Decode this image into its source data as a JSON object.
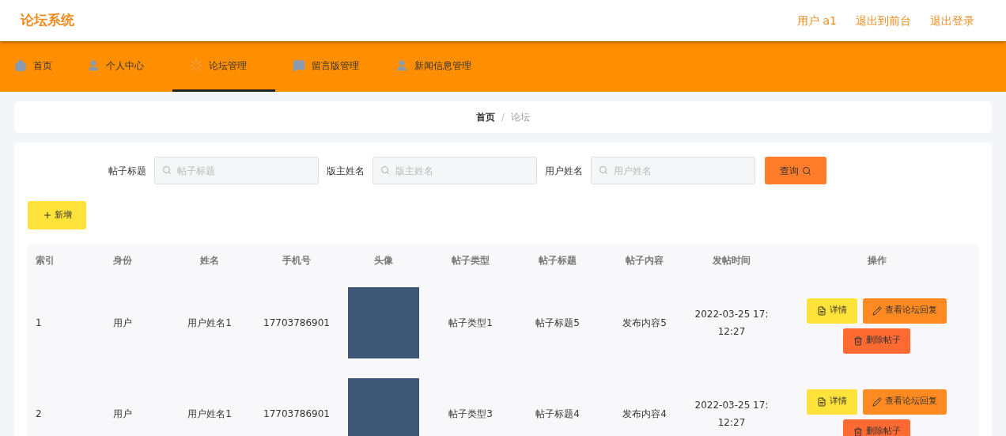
{
  "header": {
    "title": "论坛系统",
    "links": [
      "用户 a1",
      "退出到前台",
      "退出登录"
    ]
  },
  "nav": [
    {
      "label": "首页",
      "selected": false
    },
    {
      "label": "个人中心",
      "selected": false
    },
    {
      "label": "论坛管理",
      "selected": true
    },
    {
      "label": "留言版管理",
      "selected": false
    },
    {
      "label": "新闻信息管理",
      "selected": false
    }
  ],
  "breadcrumb": [
    "首页",
    "论坛"
  ],
  "breadcrumb_separator": "/",
  "search": {
    "fields": [
      {
        "label": "帖子标题",
        "placeholder": "帖子标题"
      },
      {
        "label": "版主姓名",
        "placeholder": "版主姓名"
      },
      {
        "label": "用户姓名",
        "placeholder": "用户姓名"
      }
    ],
    "button": "查询"
  },
  "add_button": "新增",
  "table": {
    "columns": [
      "索引",
      "身份",
      "姓名",
      "手机号",
      "头像",
      "帖子类型",
      "帖子标题",
      "帖子内容",
      "发帖时间",
      "操作"
    ],
    "rows": [
      {
        "cells": [
          "1",
          "用户",
          "用户姓名1",
          "17703786901",
          "",
          "帖子类型1",
          "帖子标题5",
          "发布内容5",
          "2022-03-25 17:12:27"
        ],
        "actions": [
          {
            "kind": "detail",
            "label": "详情"
          },
          {
            "kind": "reply",
            "label": "查看论坛回复"
          },
          {
            "kind": "delete",
            "label": "删除帖子"
          }
        ]
      },
      {
        "cells": [
          "2",
          "用户",
          "用户姓名1",
          "17703786901",
          "",
          "帖子类型3",
          "帖子标题4",
          "发布内容4",
          "2022-03-25 17:12:27"
        ],
        "actions": [
          {
            "kind": "detail",
            "label": "详情"
          },
          {
            "kind": "reply",
            "label": "查看论坛回复"
          },
          {
            "kind": "delete",
            "label": "删除帖子"
          }
        ]
      }
    ]
  }
}
